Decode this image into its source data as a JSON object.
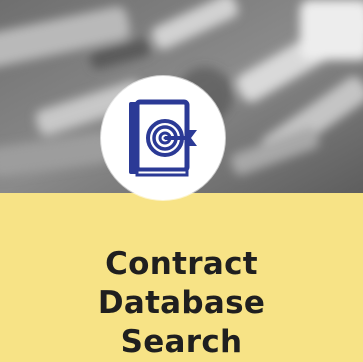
{
  "tile": {
    "title_lines": [
      "Contract",
      "Database",
      "Search"
    ],
    "icon": "book-target-icon",
    "colors": {
      "label_background": "#f7e386",
      "icon_blue": "#2b3a96",
      "text": "#1f1f1f",
      "badge": "#ffffff"
    }
  }
}
